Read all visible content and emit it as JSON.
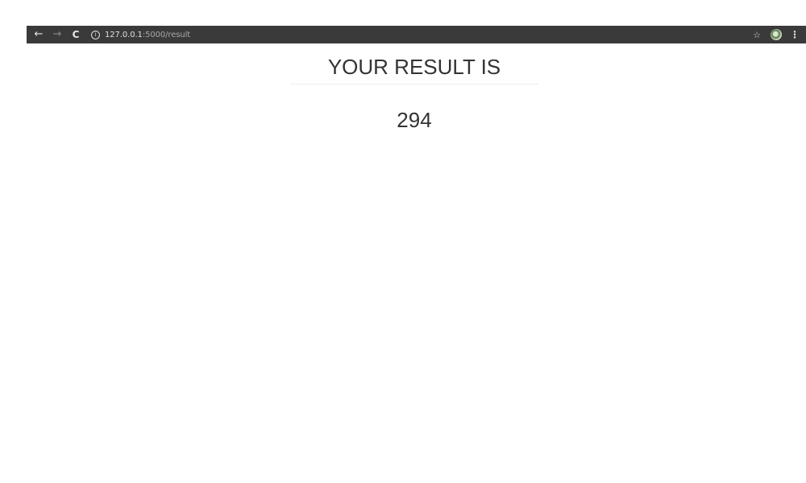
{
  "browser": {
    "back_icon": "←",
    "forward_icon": "→",
    "reload_icon": "C",
    "info_icon": "i",
    "url_host": "127.0.0.1",
    "url_path": ":5000/result",
    "star_icon": "☆",
    "menu_icon": "⋮"
  },
  "page": {
    "title": "YOUR RESULT IS",
    "result": "294"
  }
}
